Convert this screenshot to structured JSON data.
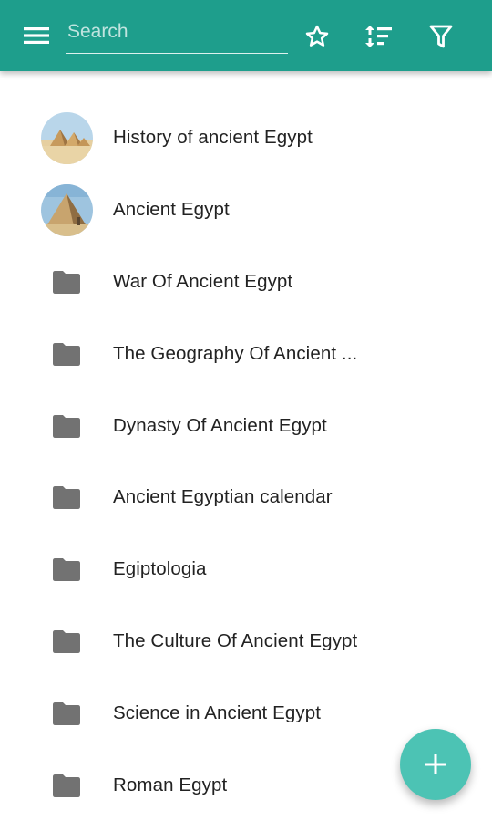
{
  "toolbar": {
    "menu_icon": "menu-icon",
    "search_placeholder": "Search",
    "search_value": "",
    "star_icon": "star-outline-icon",
    "sort_icon": "sort-icon",
    "filter_icon": "filter-icon",
    "color": "#1e9e8c"
  },
  "list": {
    "items": [
      {
        "label": "History of ancient Egypt",
        "icon": "pyramids-image-icon"
      },
      {
        "label": "Ancient Egypt",
        "icon": "pyramid-photo-icon"
      },
      {
        "label": "War Of Ancient Egypt",
        "icon": "folder-icon"
      },
      {
        "label": "The Geography Of Ancient ...",
        "icon": "folder-icon"
      },
      {
        "label": "Dynasty Of Ancient Egypt",
        "icon": "folder-icon"
      },
      {
        "label": "Ancient Egyptian calendar",
        "icon": "folder-icon"
      },
      {
        "label": "Egiptologia",
        "icon": "folder-icon"
      },
      {
        "label": "The Culture Of Ancient Egypt",
        "icon": "folder-icon"
      },
      {
        "label": "Science in Ancient Egypt",
        "icon": "folder-icon"
      },
      {
        "label": "Roman Egypt",
        "icon": "folder-icon"
      }
    ]
  },
  "fab": {
    "icon": "plus-icon",
    "color": "#4cc3b4"
  }
}
